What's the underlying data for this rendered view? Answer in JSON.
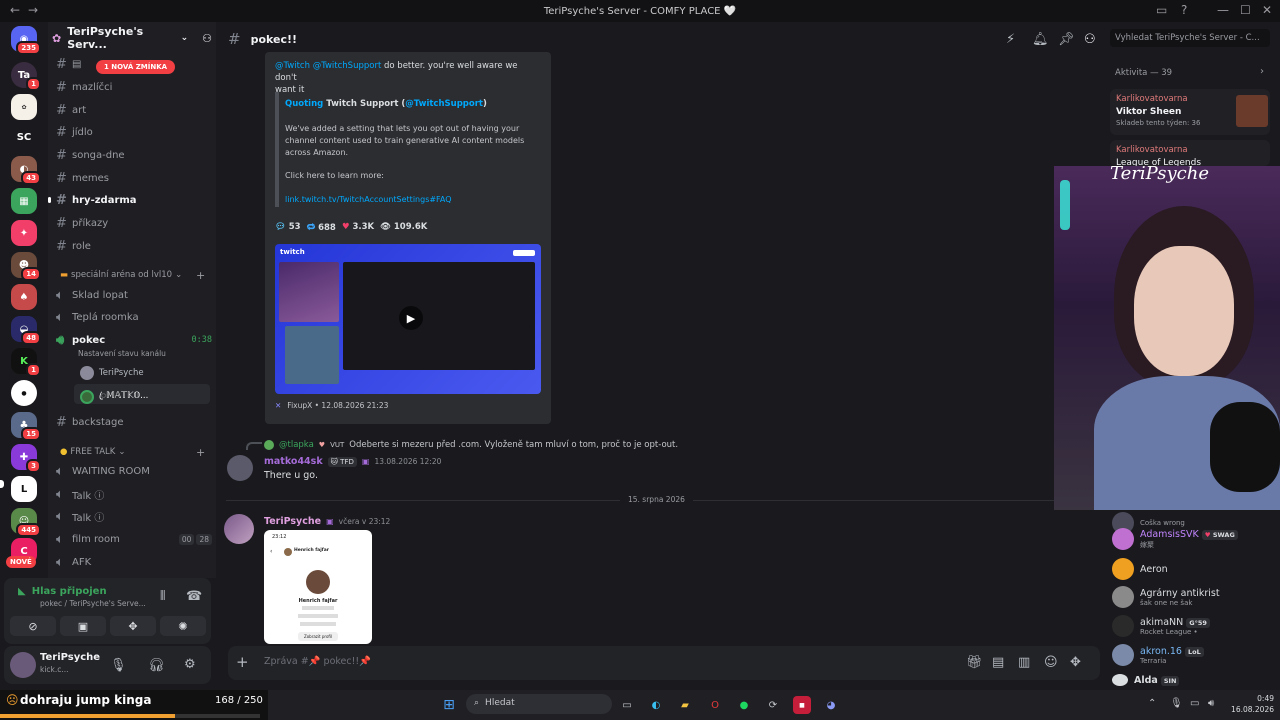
{
  "window": {
    "title": "TeriPsyche's Server - COMFY PLACE 🤍",
    "back": "←",
    "forward": "→",
    "min": "—",
    "max": "☐",
    "close": "✕"
  },
  "guilds": {
    "dm_badge": "235",
    "badges": [
      "1",
      "43",
      "14",
      "48",
      "1",
      "15",
      "3",
      "445"
    ],
    "new_label": "NOVÉ",
    "sc": "SC"
  },
  "server": {
    "name": "TeriPsyche's Serv..."
  },
  "channels": {
    "mention_banner": "1 NOVÁ ZMÍNKA",
    "items": [
      {
        "label": "mazlíčci"
      },
      {
        "label": "art"
      },
      {
        "label": "jídlo"
      },
      {
        "label": "songa-dne"
      },
      {
        "label": "memes"
      },
      {
        "label": "hry-zdarma"
      },
      {
        "label": "příkazy"
      },
      {
        "label": "role"
      }
    ],
    "cat1": "speciální aréna od lvl10",
    "voice1": [
      {
        "label": "Sklad lopat"
      },
      {
        "label": "Teplá roomka"
      }
    ],
    "pokec": {
      "label": "pokec",
      "timer": "0:38",
      "status": "Nastavení stavu kanálu"
    },
    "voice_users": [
      "TeriPsyche",
      "ꦿ𝕄𝔸𝕋𝕂𝕆..."
    ],
    "backstage": "backstage",
    "cat2": "FREE TALK",
    "voice2": [
      {
        "label": "WAITING ROOM"
      },
      {
        "label": "Talk ⓘ"
      },
      {
        "label": "Talk ⓘ"
      },
      {
        "label": "film room",
        "c1": "00",
        "c2": "28"
      },
      {
        "label": "AFK"
      }
    ]
  },
  "voice_panel": {
    "status": "Hlas připojen",
    "location": "pokec / TeriPsyche's Serve..."
  },
  "user": {
    "name": "TeriPsyche",
    "status": "kick.c..."
  },
  "chat": {
    "channel": "pokec!!",
    "search_placeholder": "Vyhledat TeriPsyche's Server - C...",
    "embed": {
      "line1a": "@Twitch @TwitchSupport",
      "line1b": " do better. you're well aware we don't",
      "line1c": "want it",
      "quoting": "Quoting",
      "quote_author": "Twitch Support (",
      "quote_handle": "@TwitchSupport",
      "quote_end": ")",
      "quote_body": "We've added a setting that lets you opt out of having your channel content used to train generative AI content models across Amazon.",
      "click": "Click here to learn more:",
      "link": "link.twitch.tv/TwitchAccountSettings#FAQ",
      "stats": {
        "replies": "53",
        "retweets": "688",
        "likes": "3.3K",
        "views": "109.6K"
      },
      "footer": "FixupX • 12.08.2026 21:23",
      "twitch_logo": "twitch"
    },
    "reply": {
      "to": "@tlapka",
      "tag": "VUT",
      "text": "Odeberte si mezeru před .com. Vyloženě tam mluví o tom, proč to je opt-out."
    },
    "msg1": {
      "author": "matko44sk",
      "tag": "TFD",
      "time": "13.08.2026 12:20",
      "text": "There u go."
    },
    "divider": "15. srpna 2026",
    "msg2": {
      "author": "TeriPsyche",
      "time": "včera v 23:12"
    },
    "phone": {
      "time": "23:12",
      "title": "Henrich fajfar",
      "name": "Henrich fajfar",
      "button": "Zobrazit profil"
    },
    "composer_placeholder": "Zpráva #📌 pokec!!📌"
  },
  "members": {
    "activity_header": "Aktivita — 39",
    "activities": [
      {
        "user": "Karlikovatovarna",
        "title": "Viktor Sheen",
        "sub": "Skladeb tento týden: 36"
      },
      {
        "user": "Karlikovatovarna",
        "title": "League of Legends"
      }
    ],
    "list": [
      {
        "name": "",
        "sub": "Coška wrong"
      },
      {
        "name": "AdamsisSVK",
        "tag": "SWAG",
        "sub": "嫁聚"
      },
      {
        "name": "Aeron",
        "sub": ""
      },
      {
        "name": "Agrárny antikrist",
        "sub": "šak one ne šak"
      },
      {
        "name": "akimaNN",
        "tag": "G°59",
        "sub": "Rocket League •"
      },
      {
        "name": "akron.16",
        "tag": "LoL",
        "sub": "Terraria"
      },
      {
        "name": "Alda",
        "tag": "SIN",
        "sub": ""
      }
    ]
  },
  "overlay": {
    "goal": "dohraju jump kinga",
    "progress": "168 / 250",
    "progress_frac": 0.672,
    "cam_name": "TeriPsyche"
  },
  "taskbar": {
    "search": "Hledat",
    "time": "0:49",
    "date": "16.08.2026"
  }
}
